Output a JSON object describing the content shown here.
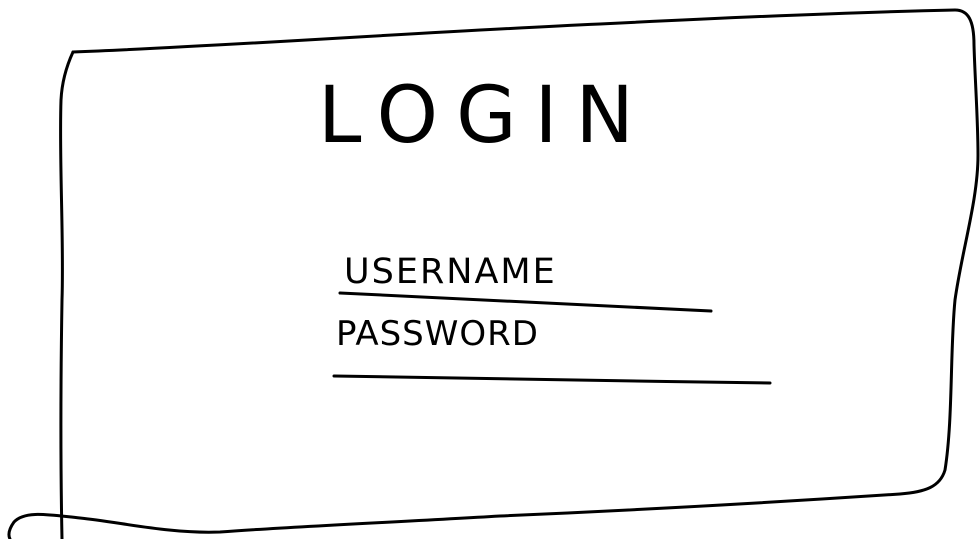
{
  "title": "LOGIN",
  "username_field": {
    "label": "USERNAME"
  },
  "password_field": {
    "label": "PASSWORD"
  },
  "ink_color": "#000000",
  "background_color": "#ffffff"
}
